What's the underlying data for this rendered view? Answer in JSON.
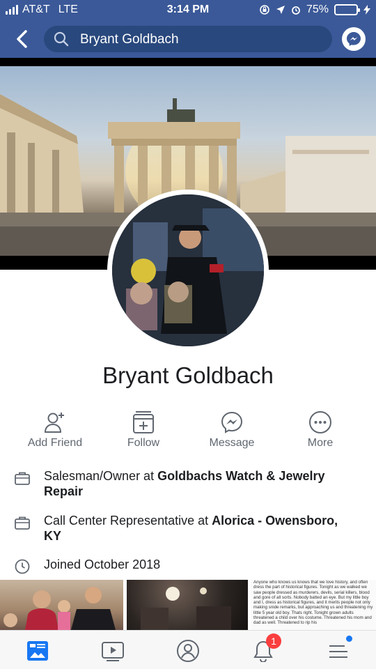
{
  "status_bar": {
    "carrier": "AT&T",
    "network": "LTE",
    "time": "3:14 PM",
    "battery_percent": "75%",
    "battery_level": 0.75
  },
  "nav": {
    "search_value": "Bryant Goldbach"
  },
  "profile": {
    "name": "Bryant Goldbach"
  },
  "actions": [
    {
      "label": "Add Friend",
      "icon": "add-friend-icon"
    },
    {
      "label": "Follow",
      "icon": "follow-icon"
    },
    {
      "label": "Message",
      "icon": "messenger-icon"
    },
    {
      "label": "More",
      "icon": "more-icon"
    }
  ],
  "intro": [
    {
      "icon": "briefcase-icon",
      "prefix": "Salesman/Owner at ",
      "bold": "Goldbachs Watch & Jewelry Repair"
    },
    {
      "icon": "briefcase-icon",
      "prefix": "Call Center Representative at ",
      "bold": "Alorica - Owensboro, KY"
    },
    {
      "icon": "clock-icon",
      "prefix": "Joined October 2018",
      "bold": ""
    }
  ],
  "photo_text": "Anyone who knows us knows that we love history, and often dress the part of historical figures. Tonight as we walked we saw people dressed as murderers, devils, serial killers, blood and gore of all sorts. Nobody batted an eye. But my little boy and I, dress as historical figures, and it merits people not only making snide remarks, but approaching us and threatening my little 5 year old boy. Thats right. Tonight grown adults threatened a child over his costume. Threatened his mom and dad as well. Threatened to rip his",
  "tabbar": {
    "notifications_count": "1"
  },
  "colors": {
    "brand": "#3b5998",
    "search_bg": "#29487d",
    "badge": "#fa3e3e",
    "battery": "#4cd964"
  }
}
